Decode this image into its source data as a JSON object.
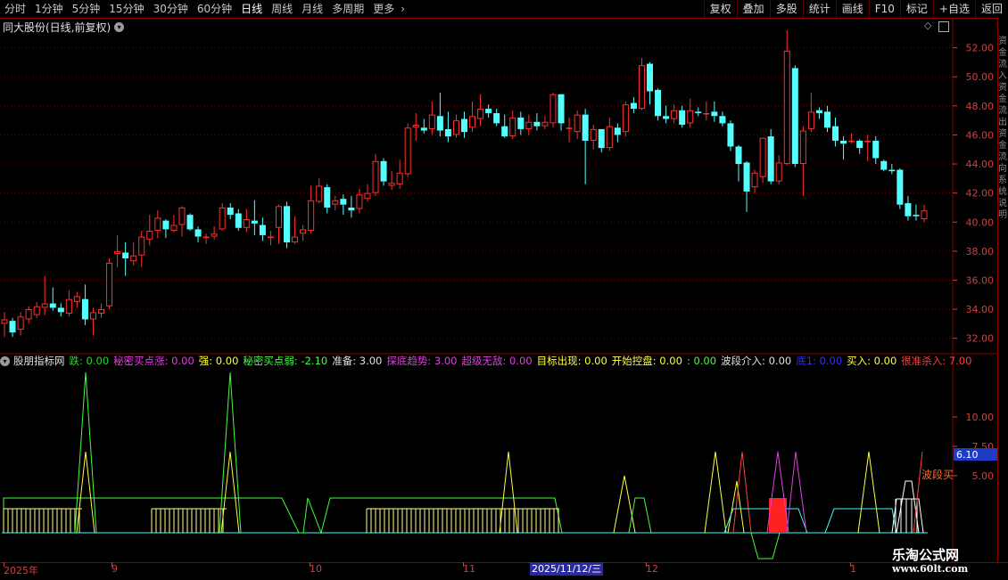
{
  "toolbar": {
    "periods": [
      "分时",
      "1分钟",
      "5分钟",
      "15分钟",
      "30分钟",
      "60分钟",
      "日线",
      "周线",
      "月线",
      "多周期",
      "更多"
    ],
    "active_period": "日线",
    "more_arrow": "chevron-right-icon",
    "actions": [
      "复权",
      "叠加",
      "多股",
      "统计",
      "画线",
      "F10",
      "标记",
      "+自选",
      "返回"
    ]
  },
  "stock": {
    "title": "同大股份(日线,前复权)"
  },
  "price_axis": {
    "ticks": [
      "52.00",
      "50.00",
      "48.00",
      "46.00",
      "44.00",
      "42.00",
      "40.00",
      "38.00",
      "36.00",
      "34.00",
      "32.00"
    ]
  },
  "indicator": {
    "name": "股朋指标网",
    "fields": [
      {
        "label": "跌: 0.00",
        "color": "#22dd22"
      },
      {
        "label": "秘密买点涨: 0.00",
        "color": "#e040e0"
      },
      {
        "label": "强: 0.00",
        "color": "#ffff40"
      },
      {
        "label": "秘密买点弱: -2.10",
        "color": "#40ff40"
      },
      {
        "label": "准备: 3.00",
        "color": "#e0e0e0"
      },
      {
        "label": "探底趋势: 3.00",
        "color": "#e040e0"
      },
      {
        "label": "超级无敌: 0.00",
        "color": "#e040e0"
      },
      {
        "label": "目标出现: 0.00",
        "color": "#ffff40"
      },
      {
        "label": "开始控盘: 0.00",
        "color": "#ffff40"
      },
      {
        "label": ": 0.00",
        "color": "#40ff40"
      },
      {
        "label": "波段介入: 0.00",
        "color": "#e0e0e0"
      },
      {
        "label": "底1: 0.00",
        "color": "#3030ff"
      },
      {
        "label": "买入: 0.00",
        "color": "#ffff40"
      },
      {
        "label": "很准杀入: 7.00",
        "color": "#ff4040"
      }
    ],
    "axis_ticks": [
      "10.00",
      "7.50",
      "5.00"
    ],
    "current_value": "6.10",
    "annotation": "波段买"
  },
  "date_axis": {
    "labels": [
      "2025年",
      "9",
      "10",
      "11",
      "12",
      "1"
    ],
    "highlight": "2025/11/12/三"
  },
  "right_panel_text": "资金流入资金流出资金流向系统说明",
  "watermark": {
    "line1": "乐淘公式网",
    "line2": "www.60lt.com"
  },
  "colors": {
    "up": "#ff3030",
    "down": "#54ffff",
    "grid": "#8b0000",
    "axis_text": "#d04040"
  },
  "chart_data": {
    "type": "candlestick",
    "ylim": [
      31,
      54
    ],
    "candles": [
      [
        33.0,
        33.3,
        32.1,
        33.8
      ],
      [
        33.2,
        32.4,
        32.1,
        33.4
      ],
      [
        32.6,
        33.5,
        32.2,
        33.8
      ],
      [
        33.3,
        34.0,
        33.0,
        34.2
      ],
      [
        33.6,
        34.2,
        33.4,
        34.5
      ],
      [
        34.1,
        34.4,
        33.6,
        36.3
      ],
      [
        34.4,
        34.1,
        33.9,
        35.5
      ],
      [
        34.1,
        33.8,
        33.5,
        34.4
      ],
      [
        33.7,
        34.7,
        33.5,
        35.3
      ],
      [
        34.5,
        34.9,
        34.1,
        35.2
      ],
      [
        34.7,
        33.3,
        32.9,
        35.7
      ],
      [
        33.3,
        33.8,
        32.2,
        34.1
      ],
      [
        33.7,
        34.0,
        33.4,
        34.4
      ],
      [
        34.2,
        37.2,
        34.0,
        37.5
      ],
      [
        37.8,
        38.0,
        36.9,
        39.1
      ],
      [
        37.9,
        37.5,
        36.3,
        38.6
      ],
      [
        37.3,
        37.7,
        37.0,
        38.6
      ],
      [
        37.7,
        39.0,
        36.9,
        39.4
      ],
      [
        38.8,
        39.4,
        38.4,
        40.5
      ],
      [
        39.4,
        40.3,
        38.9,
        40.8
      ],
      [
        40.1,
        39.5,
        38.9,
        40.2
      ],
      [
        39.4,
        39.8,
        39.3,
        40.5
      ],
      [
        39.8,
        41.0,
        39.0,
        41.1
      ],
      [
        40.5,
        39.5,
        39.4,
        40.6
      ],
      [
        39.5,
        39.0,
        38.6,
        39.7
      ],
      [
        38.9,
        39.0,
        38.5,
        39.2
      ],
      [
        39.0,
        39.2,
        38.8,
        39.7
      ],
      [
        39.5,
        41.0,
        39.4,
        41.3
      ],
      [
        41.0,
        40.5,
        40.2,
        41.3
      ],
      [
        40.6,
        39.6,
        39.4,
        40.9
      ],
      [
        39.6,
        40.2,
        39.3,
        40.9
      ],
      [
        40.1,
        39.9,
        39.1,
        41.5
      ],
      [
        39.8,
        39.1,
        38.7,
        40.3
      ],
      [
        39.0,
        39.0,
        38.4,
        39.4
      ],
      [
        39.6,
        41.1,
        38.5,
        41.2
      ],
      [
        41.1,
        38.6,
        38.2,
        41.4
      ],
      [
        38.6,
        39.0,
        38.5,
        40.4
      ],
      [
        39.2,
        39.5,
        38.7,
        39.8
      ],
      [
        39.4,
        41.5,
        39.2,
        42.5
      ],
      [
        41.4,
        42.5,
        41.3,
        43.0
      ],
      [
        42.4,
        41.0,
        40.6,
        42.6
      ],
      [
        41.2,
        41.5,
        40.8,
        41.8
      ],
      [
        41.6,
        41.2,
        40.5,
        41.9
      ],
      [
        41.0,
        40.8,
        40.3,
        41.8
      ],
      [
        40.9,
        41.9,
        40.6,
        42.3
      ],
      [
        41.6,
        42.0,
        41.4,
        42.6
      ],
      [
        42.0,
        44.2,
        41.8,
        44.7
      ],
      [
        44.2,
        42.8,
        42.5,
        44.4
      ],
      [
        42.5,
        42.7,
        42.2,
        43.5
      ],
      [
        42.6,
        43.4,
        42.3,
        44.3
      ],
      [
        43.3,
        46.5,
        43.1,
        46.8
      ],
      [
        46.5,
        46.7,
        45.6,
        47.5
      ],
      [
        46.5,
        46.3,
        46.1,
        47.1
      ],
      [
        46.4,
        47.4,
        46.0,
        48.3
      ],
      [
        47.3,
        46.3,
        45.9,
        48.9
      ],
      [
        46.4,
        45.9,
        45.5,
        47.6
      ],
      [
        46.0,
        47.0,
        45.8,
        47.4
      ],
      [
        47.1,
        46.2,
        45.8,
        47.6
      ],
      [
        46.5,
        47.3,
        46.2,
        48.3
      ],
      [
        47.1,
        47.8,
        46.6,
        48.8
      ],
      [
        47.8,
        47.5,
        47.2,
        48.1
      ],
      [
        47.5,
        46.8,
        46.6,
        47.8
      ],
      [
        46.6,
        45.9,
        45.8,
        47.4
      ],
      [
        45.9,
        47.2,
        45.7,
        47.7
      ],
      [
        47.2,
        46.4,
        46.0,
        47.6
      ],
      [
        46.4,
        46.9,
        46.0,
        47.4
      ],
      [
        46.9,
        46.6,
        46.3,
        47.5
      ],
      [
        46.6,
        46.9,
        46.4,
        47.3
      ],
      [
        46.8,
        48.8,
        46.5,
        48.9
      ],
      [
        48.8,
        46.8,
        46.3,
        48.7
      ],
      [
        46.5,
        46.5,
        45.5,
        47.2
      ],
      [
        46.2,
        47.4,
        45.7,
        47.7
      ],
      [
        47.4,
        45.6,
        42.6,
        47.8
      ],
      [
        45.6,
        46.4,
        45.0,
        46.7
      ],
      [
        46.4,
        45.1,
        44.8,
        46.4
      ],
      [
        45.1,
        46.6,
        44.9,
        47.2
      ],
      [
        46.5,
        46.0,
        45.5,
        46.8
      ],
      [
        46.2,
        48.1,
        45.9,
        48.3
      ],
      [
        48.2,
        47.8,
        47.5,
        48.6
      ],
      [
        47.8,
        50.8,
        47.7,
        51.3
      ],
      [
        50.9,
        49.0,
        48.1,
        51.0
      ],
      [
        49.1,
        47.3,
        47.0,
        49.2
      ],
      [
        47.3,
        47.1,
        46.8,
        48.0
      ],
      [
        47.1,
        47.7,
        46.8,
        48.1
      ],
      [
        47.7,
        46.7,
        46.5,
        48.0
      ],
      [
        46.8,
        47.7,
        46.5,
        48.5
      ],
      [
        47.6,
        47.5,
        47.3,
        47.9
      ],
      [
        47.5,
        47.5,
        47.0,
        48.3
      ],
      [
        47.6,
        47.3,
        46.9,
        48.3
      ],
      [
        47.3,
        46.8,
        46.6,
        47.6
      ],
      [
        46.8,
        45.2,
        44.9,
        47.0
      ],
      [
        45.2,
        44.0,
        42.8,
        45.3
      ],
      [
        44.1,
        42.1,
        40.7,
        44.2
      ],
      [
        42.4,
        43.4,
        42.0,
        43.6
      ],
      [
        43.1,
        45.8,
        42.7,
        45.8
      ],
      [
        45.9,
        42.8,
        42.6,
        46.4
      ],
      [
        42.8,
        44.1,
        42.6,
        44.6
      ],
      [
        44.0,
        51.8,
        43.9,
        53.2
      ],
      [
        50.6,
        44.0,
        43.8,
        50.8
      ],
      [
        44.0,
        46.3,
        41.8,
        46.6
      ],
      [
        46.4,
        47.6,
        46.2,
        48.9
      ],
      [
        47.7,
        47.5,
        47.1,
        47.9
      ],
      [
        47.6,
        46.5,
        46.2,
        48.0
      ],
      [
        46.6,
        45.6,
        45.2,
        47.2
      ],
      [
        45.6,
        45.4,
        44.3,
        45.9
      ],
      [
        45.6,
        45.6,
        45.4,
        46.1
      ],
      [
        45.6,
        45.1,
        44.7,
        45.7
      ],
      [
        45.5,
        45.6,
        44.2,
        46.0
      ],
      [
        45.6,
        44.4,
        44.0,
        45.9
      ],
      [
        44.2,
        43.6,
        43.5,
        44.3
      ],
      [
        43.6,
        43.5,
        43.3,
        44.0
      ],
      [
        43.6,
        41.2,
        40.9,
        43.7
      ],
      [
        41.3,
        40.4,
        40.1,
        41.8
      ],
      [
        40.5,
        40.4,
        40.1,
        41.2
      ],
      [
        40.2,
        40.8,
        40.0,
        41.2
      ]
    ]
  }
}
